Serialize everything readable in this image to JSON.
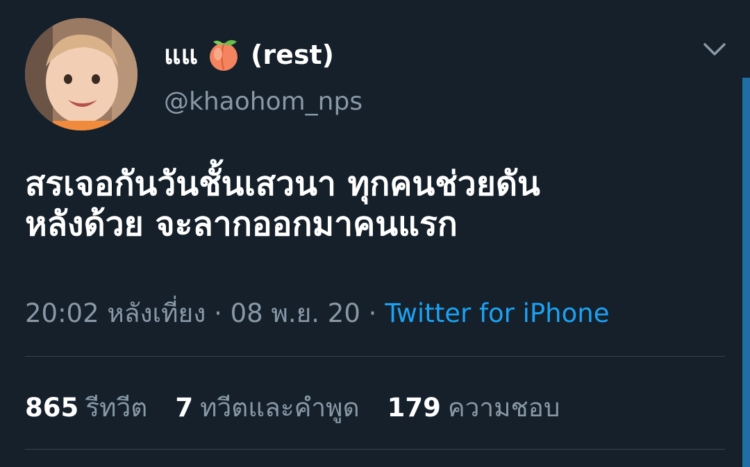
{
  "tweet": {
    "display_name_prefix": "แแ",
    "display_name_suffix": "(rest)",
    "display_name_emoji": "peach-icon",
    "handle": "@khaohom_nps",
    "text_line1": "สรเจอกันวันชั้นเสวนา ทุกคนช่วยดัน",
    "text_line2": "หลังด้วย จะลากออกมาคนแรก",
    "time": "20:02 หลังเที่ยง",
    "separator": "·",
    "date": "08 พ.ย. 20",
    "source": "Twitter for iPhone"
  },
  "stats": {
    "retweets_count": "865",
    "retweets_label": "รีทวีต",
    "quotes_count": "7",
    "quotes_label": "ทวีตและคำพูด",
    "likes_count": "179",
    "likes_label": "ความชอบ"
  },
  "colors": {
    "background": "#15202b",
    "secondary_text": "#8899a6",
    "accent": "#1da1f2",
    "divider": "#38444d"
  }
}
